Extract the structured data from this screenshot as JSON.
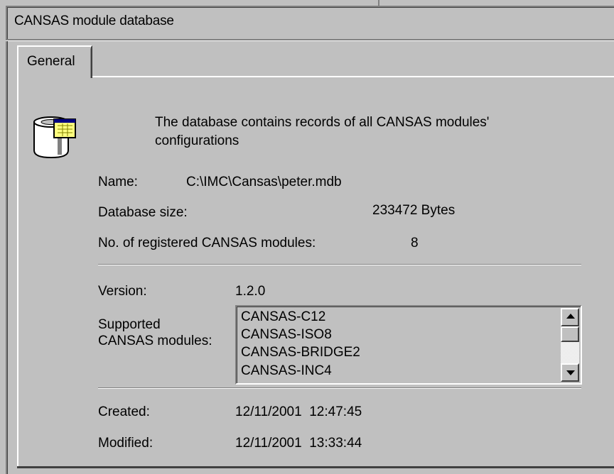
{
  "window": {
    "title": "CANSAS module database"
  },
  "tabs": [
    {
      "label": "General",
      "selected": true
    }
  ],
  "general": {
    "description_line1": "The database contains records of all CANSAS modules'",
    "description_line2": "configurations",
    "name_label": "Name:",
    "name_value": "C:\\IMC\\Cansas\\peter.mdb",
    "size_label": "Database size:",
    "size_value": "233472 Bytes",
    "count_label": "No. of registered CANSAS modules:",
    "count_value": "8",
    "version_label": "Version:",
    "version_value": "1.2.0",
    "supported_label_line1": "Supported",
    "supported_label_line2": "CANSAS modules:",
    "supported_modules": [
      "CANSAS-C12",
      "CANSAS-ISO8",
      "CANSAS-BRIDGE2",
      "CANSAS-INC4"
    ],
    "created_label": "Created:",
    "created_value": "12/11/2001  12:47:45",
    "modified_label": "Modified:",
    "modified_value": "12/11/2001  13:33:44"
  },
  "icons": {
    "database": "database-icon",
    "scroll_up": "arrow-up-icon",
    "scroll_down": "arrow-down-icon"
  },
  "colors": {
    "face": "#c0c0c0",
    "shadow": "#808080",
    "highlight": "#ffffff",
    "dark": "#404040"
  }
}
